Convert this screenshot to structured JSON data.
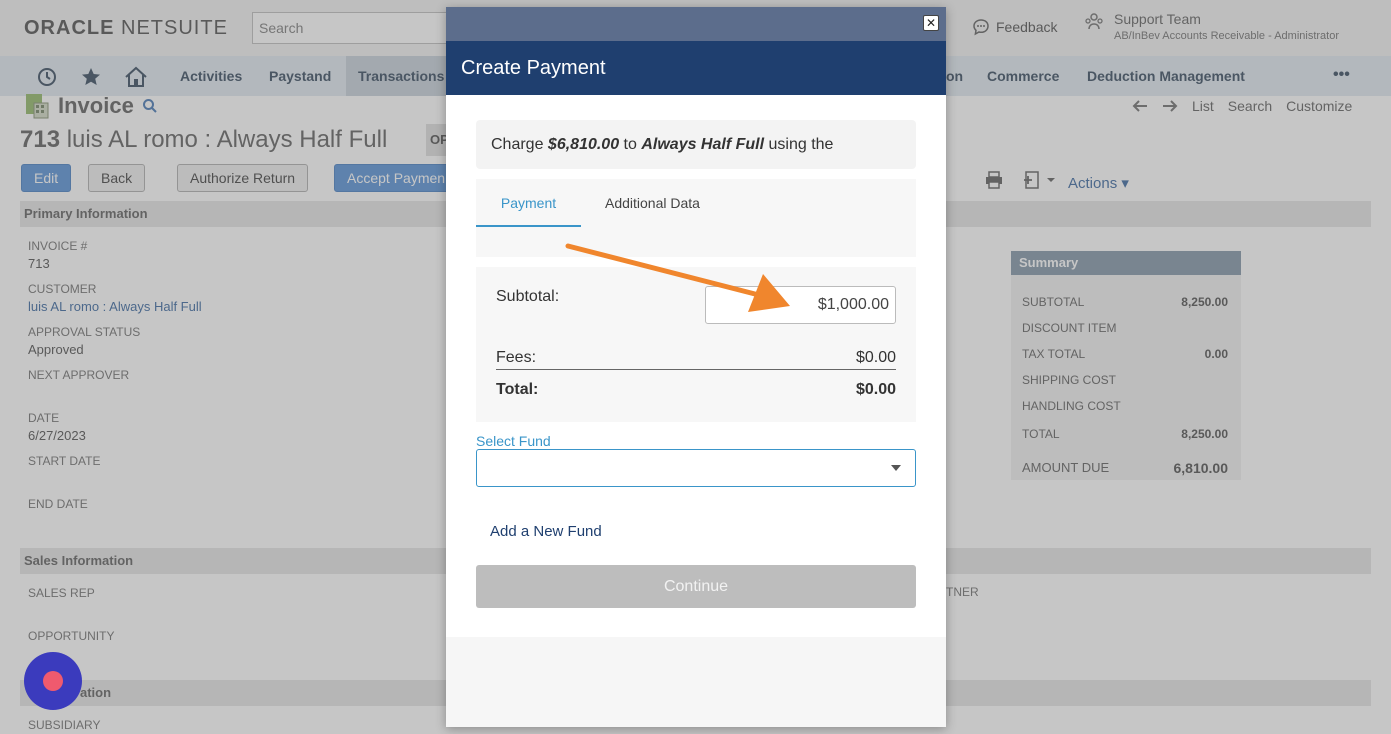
{
  "topbar": {
    "logo_brand": "ORACLE",
    "logo_product": "NETSUITE",
    "search_placeholder": "Search",
    "feedback_label": "Feedback",
    "support_name": "Support Team",
    "support_role": "AB/InBev Accounts Receivable - Administrator"
  },
  "nav": {
    "icons": [
      "recent-history-icon",
      "star-icon",
      "home-icon"
    ],
    "items": [
      {
        "label": "Activities"
      },
      {
        "label": "Paystand"
      },
      {
        "label": "Transactions"
      },
      {
        "label": "on"
      },
      {
        "label": "Commerce"
      },
      {
        "label": "Deduction Management"
      }
    ],
    "more_label": "•••"
  },
  "record": {
    "type_title": "Invoice",
    "number": "713",
    "name": "luis AL romo : Always Half Full",
    "status_partial": "OP"
  },
  "record_nav": {
    "list": "List",
    "search": "Search",
    "customize": "Customize"
  },
  "buttons": {
    "edit": "Edit",
    "back": "Back",
    "authorize_return": "Authorize Return",
    "accept_payment": "Accept Paymen",
    "actions": "Actions"
  },
  "sections": {
    "primary": "Primary Information",
    "sales": "Sales Information",
    "third_partial": "ation"
  },
  "fields": {
    "invoice_label": "INVOICE #",
    "invoice_value": "713",
    "customer_label": "CUSTOMER",
    "customer_value": "luis AL romo : Always Half Full",
    "approval_label": "APPROVAL STATUS",
    "approval_value": "Approved",
    "next_approver_label": "NEXT APPROVER",
    "date_label": "DATE",
    "date_value": "6/27/2023",
    "start_date_label": "START DATE",
    "end_date_label": "END DATE",
    "sales_rep_label": "SALES REP",
    "opportunity_label": "OPPORTUNITY",
    "subsidiary_label": "SUBSIDIARY",
    "partner_partial": "TNER"
  },
  "summary": {
    "title": "Summary",
    "rows": [
      {
        "label": "SUBTOTAL",
        "value": "8,250.00"
      },
      {
        "label": "DISCOUNT ITEM",
        "value": ""
      },
      {
        "label": "TAX TOTAL",
        "value": "0.00"
      },
      {
        "label": "SHIPPING COST",
        "value": ""
      },
      {
        "label": "HANDLING COST",
        "value": ""
      },
      {
        "label": "TOTAL",
        "value": "8,250.00"
      },
      {
        "label": "AMOUNT DUE",
        "value": "6,810.00"
      }
    ]
  },
  "modal": {
    "close_glyph": "✕",
    "title": "Create Payment",
    "charge_prefix": "Charge ",
    "charge_amount": "$6,810.00",
    "charge_mid": " to ",
    "charge_customer": "Always Half Full",
    "charge_suffix": " using the",
    "tabs": [
      {
        "label": "Payment",
        "active": true
      },
      {
        "label": "Additional Data",
        "active": false
      }
    ],
    "subtotal_label": "Subtotal:",
    "subtotal_value": "$1,000.00",
    "fees_label": "Fees:",
    "fees_value": "$0.00",
    "total_label": "Total:",
    "total_value": "$0.00",
    "fund_label": "Select Fund",
    "fund_value": "",
    "add_fund_label": "Add a New Fund",
    "continue_label": "Continue"
  },
  "colors": {
    "modal_header": "#1f3f6f",
    "accent_blue": "#3a95c9",
    "annotation_arrow": "#f0862d",
    "chat_bubble": "#3b3bbd"
  }
}
